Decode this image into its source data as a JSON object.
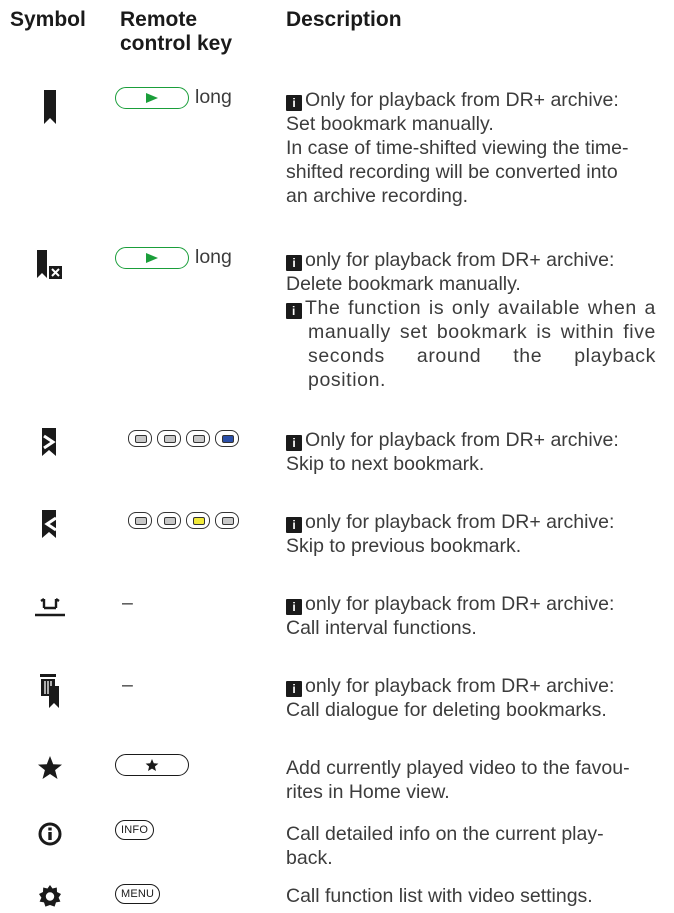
{
  "header": {
    "symbol": "Symbol",
    "remote_line1": "Remote",
    "remote_line2": "control key",
    "description": "Description"
  },
  "rows": [
    {
      "symbol_icon": "bookmark-set-icon",
      "key_text": "long",
      "lines": [
        "Only for playback from DR+ archive:",
        "Set bookmark manually.",
        "In case of time-shifted viewing the time-",
        "shifted recording will be converted into",
        "an archive recording."
      ]
    },
    {
      "symbol_icon": "bookmark-delete-icon",
      "key_text": "long",
      "lines": [
        "only for playback from DR+ archive:",
        "Delete bookmark manually.",
        "The function is only available when a manually set bookmark is within five seconds around the playback position."
      ]
    },
    {
      "symbol_icon": "bookmark-next-icon",
      "key_colors": [
        "#c8c8c8",
        "#c8c8c8",
        "#c8c8c8",
        "#2b4fa8"
      ],
      "lines": [
        "Only for playback from DR+ archive:",
        "Skip to next bookmark."
      ]
    },
    {
      "symbol_icon": "bookmark-previous-icon",
      "key_colors": [
        "#c8c8c8",
        "#c8c8c8",
        "#f2ea3a",
        "#c8c8c8"
      ],
      "lines": [
        "only for playback from DR+ archive:",
        "Skip to previous bookmark."
      ]
    },
    {
      "symbol_icon": "interval-icon",
      "key_text": "–",
      "lines": [
        "only for playback from DR+ archive:",
        "Call interval functions."
      ]
    },
    {
      "symbol_icon": "delete-bookmarks-icon",
      "key_text": "–",
      "lines": [
        "only for playback from DR+ archive:",
        "Call dialogue for deleting bookmarks."
      ]
    },
    {
      "symbol_icon": "star-icon",
      "lines": [
        "Add currently played video to the favou-",
        "rites in Home view."
      ]
    },
    {
      "symbol_icon": "info-circle-icon",
      "key_text": "INFO",
      "lines": [
        "Call detailed info on the current play-",
        "back."
      ]
    },
    {
      "symbol_icon": "gear-icon",
      "key_text": "MENU",
      "lines": [
        "Call function list with video settings."
      ]
    }
  ],
  "info_glyph": "i",
  "colors": {
    "play_key": "#1a9e3a",
    "text": "#3c3c3c",
    "black": "#1a1a1a"
  }
}
